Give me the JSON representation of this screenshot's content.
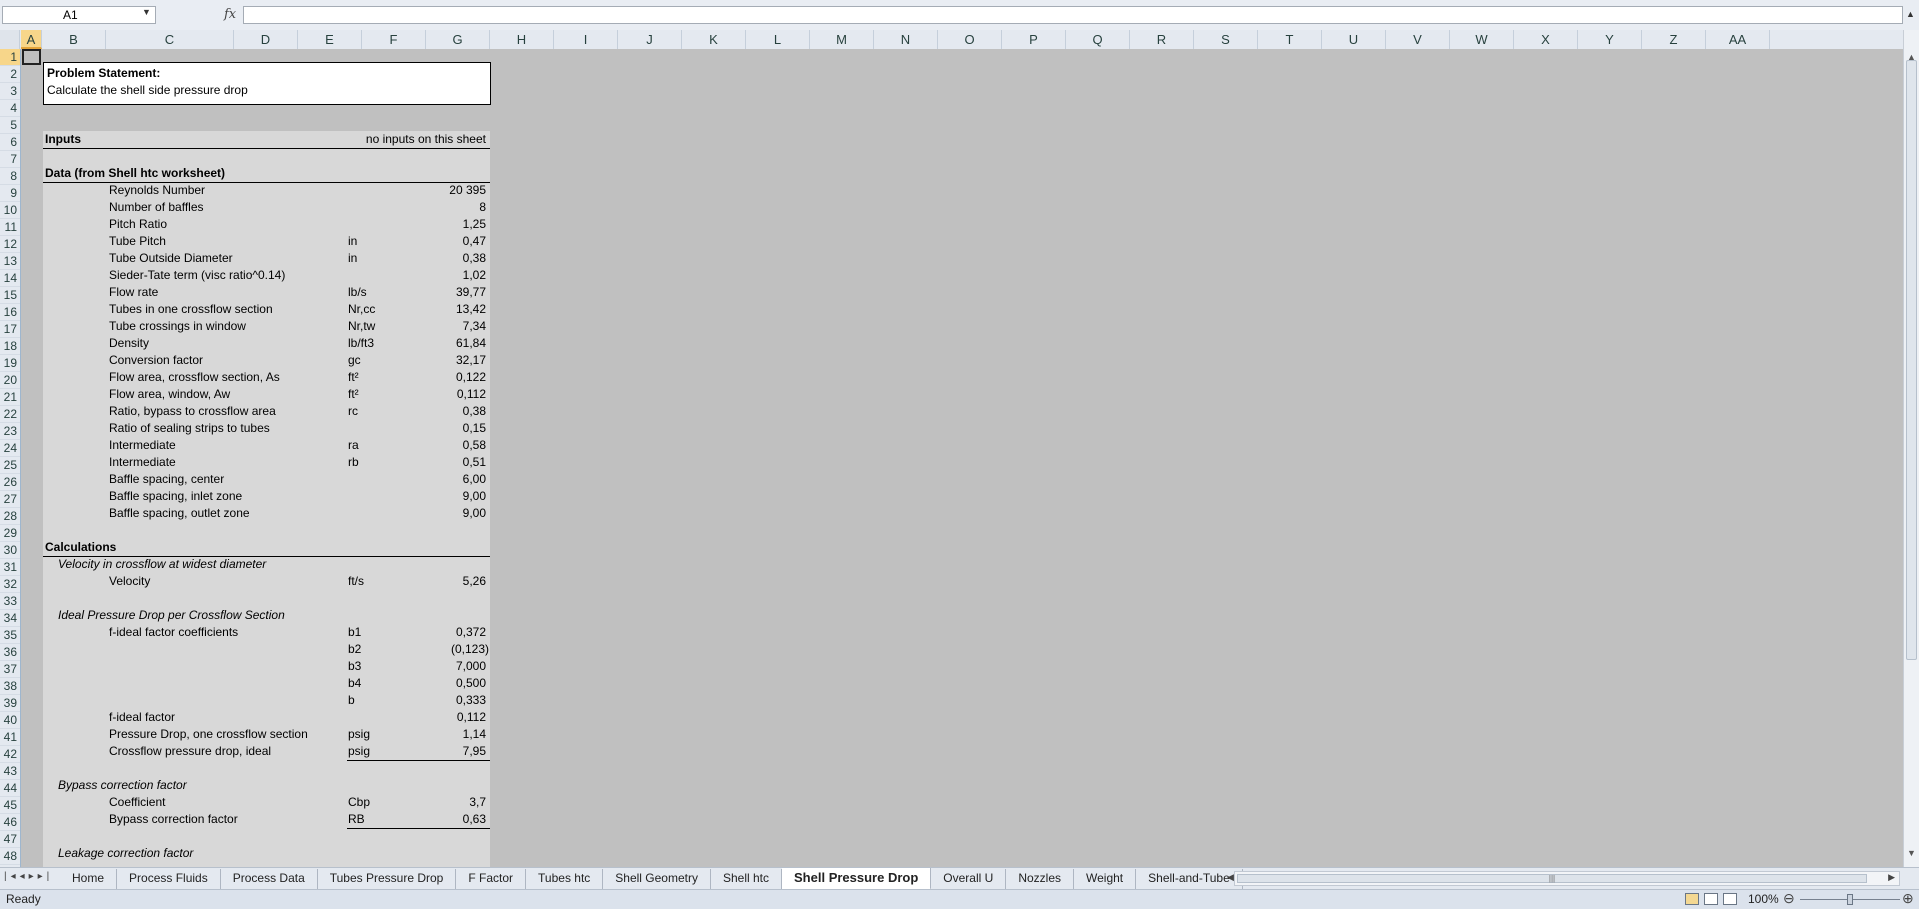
{
  "formula_bar": {
    "name_box": "A1",
    "fx_label": "fx",
    "formula": ""
  },
  "columns": [
    "A",
    "B",
    "C",
    "D",
    "E",
    "F",
    "G",
    "H",
    "I",
    "J",
    "K",
    "L",
    "M",
    "N",
    "O",
    "P",
    "Q",
    "R",
    "S",
    "T",
    "U",
    "V",
    "W",
    "X",
    "Y",
    "Z",
    "AA"
  ],
  "rows": [
    "1",
    "2",
    "3",
    "4",
    "5",
    "6",
    "7",
    "8",
    "9",
    "10",
    "11",
    "12",
    "13",
    "14",
    "15",
    "16",
    "17",
    "18",
    "19",
    "20",
    "21",
    "22",
    "23",
    "24",
    "25",
    "26",
    "27",
    "28",
    "29",
    "30",
    "31",
    "32",
    "33",
    "34",
    "35",
    "36",
    "37",
    "38",
    "39",
    "40",
    "41",
    "42",
    "43",
    "44",
    "45",
    "46",
    "47",
    "48"
  ],
  "problem": {
    "title": "Problem Statement:",
    "text": "Calculate the shell side pressure drop"
  },
  "inputs": {
    "label": "Inputs",
    "note": "no inputs on this sheet"
  },
  "data_section": {
    "title": "Data (from Shell htc worksheet)",
    "items": [
      {
        "label": "Reynolds Number",
        "unit": "",
        "value": "20 395"
      },
      {
        "label": "Number of baffles",
        "unit": "",
        "value": "8"
      },
      {
        "label": "Pitch Ratio",
        "unit": "",
        "value": "1,25"
      },
      {
        "label": "Tube Pitch",
        "unit": "in",
        "value": "0,47"
      },
      {
        "label": "Tube Outside Diameter",
        "unit": "in",
        "value": "0,38"
      },
      {
        "label": "Sieder-Tate term (visc ratio^0.14)",
        "unit": "",
        "value": "1,02"
      },
      {
        "label": "Flow rate",
        "unit": "lb/s",
        "value": "39,77"
      },
      {
        "label": "Tubes in one crossflow section",
        "unit": "Nr,cc",
        "value": "13,42"
      },
      {
        "label": "Tube crossings in window",
        "unit": "Nr,tw",
        "value": "7,34"
      },
      {
        "label": "Density",
        "unit": "lb/ft3",
        "value": "61,84"
      },
      {
        "label": "Conversion factor",
        "unit": "gc",
        "value": "32,17"
      },
      {
        "label": "Flow area, crossflow section, As",
        "unit": "ft²",
        "value": "0,122"
      },
      {
        "label": "Flow area, window, Aw",
        "unit": "ft²",
        "value": "0,112"
      },
      {
        "label": "Ratio, bypass to crossflow area",
        "unit": "rc",
        "value": "0,38"
      },
      {
        "label": "Ratio of sealing strips to tubes",
        "unit": "",
        "value": "0,15"
      },
      {
        "label": "Intermediate",
        "unit": "ra",
        "value": "0,58"
      },
      {
        "label": "Intermediate",
        "unit": "rb",
        "value": "0,51"
      },
      {
        "label": "Baffle spacing, center",
        "unit": "",
        "value": "6,00"
      },
      {
        "label": "Baffle spacing, inlet zone",
        "unit": "",
        "value": "9,00"
      },
      {
        "label": "Baffle spacing, outlet zone",
        "unit": "",
        "value": "9,00"
      }
    ]
  },
  "calculations": {
    "title": "Calculations",
    "velocity_header": "Velocity in crossflow at widest diameter",
    "velocity": {
      "label": "Velocity",
      "unit": "ft/s",
      "value": "5,26"
    },
    "ideal_header": "Ideal Pressure Drop per Crossflow Section",
    "coeff_label": "f-ideal factor coefficients",
    "coeffs": [
      {
        "unit": "b1",
        "value": "0,372"
      },
      {
        "unit": "b2",
        "value": "(0,123)"
      },
      {
        "unit": "b3",
        "value": "7,000"
      },
      {
        "unit": "b4",
        "value": "0,500"
      },
      {
        "unit": "b",
        "value": "0,333"
      }
    ],
    "f_ideal": {
      "label": "f-ideal factor",
      "unit": "",
      "value": "0,112"
    },
    "dp_one": {
      "label": "Pressure Drop, one crossflow section",
      "unit": "psig",
      "value": "1,14"
    },
    "dp_ideal": {
      "label": "Crossflow pressure drop, ideal",
      "unit": "psig",
      "value": "7,95"
    },
    "bypass_header": "Bypass correction factor",
    "coefficient": {
      "label": "Coefficient",
      "unit": "Cbp",
      "value": "3,7"
    },
    "bypass": {
      "label": "Bypass correction factor",
      "unit": "RB",
      "value": "0,63"
    },
    "leakage_header": "Leakage correction factor"
  },
  "sheet_tabs": [
    "Home",
    "Process Fluids",
    "Process Data",
    "Tubes Pressure Drop",
    "F Factor",
    "Tubes htc",
    "Shell Geometry",
    "Shell htc",
    "Shell Pressure Drop",
    "Overall U",
    "Nozzles",
    "Weight",
    "Shell-and-Tube"
  ],
  "active_tab": "Shell Pressure Drop",
  "status": {
    "text": "Ready",
    "zoom": "100%",
    "zoom_fraction": 0.5
  }
}
